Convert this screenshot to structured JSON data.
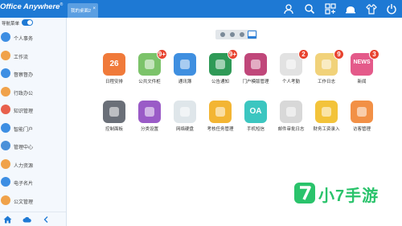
{
  "header": {
    "brand": "Office Anywhere",
    "brand_mark": "®",
    "tab_label": "我的桌面2",
    "tab_close": "×",
    "icons": [
      "user-icon",
      "search-icon",
      "apps-icon",
      "chat-icon",
      "theme-icon",
      "power-icon"
    ]
  },
  "sidebar": {
    "toggle_label": "导航菜单",
    "toggle_on": true,
    "items": [
      {
        "label": "个人事务",
        "icon": "person-icon",
        "color": "#3d8ee3"
      },
      {
        "label": "工作流",
        "icon": "workflow-icon",
        "color": "#f0a24a"
      },
      {
        "label": "督察督办",
        "icon": "supervise-icon",
        "color": "#3d8ee3"
      },
      {
        "label": "行政办公",
        "icon": "admin-icon",
        "color": "#f0a24a"
      },
      {
        "label": "知识管理",
        "icon": "knowledge-icon",
        "color": "#e8604c"
      },
      {
        "label": "智能门户",
        "icon": "portal-icon",
        "color": "#3d8ee3"
      },
      {
        "label": "管理中心",
        "icon": "management-icon",
        "color": "#4a90d9"
      },
      {
        "label": "人力资源",
        "icon": "hr-icon",
        "color": "#f0a24a"
      },
      {
        "label": "电子名片",
        "icon": "card-icon",
        "color": "#3d8ee3"
      },
      {
        "label": "公文管理",
        "icon": "document-icon",
        "color": "#f0a24a"
      }
    ],
    "footer_icons": [
      "home-icon",
      "cloud-icon",
      "collapse-icon"
    ]
  },
  "pager": {
    "pages": 3,
    "icon": "grid-icon"
  },
  "apps": [
    {
      "label": "日程安排",
      "icon": "calendar-icon",
      "color": "#f07a3a",
      "badge": "",
      "glyph": "26"
    },
    {
      "label": "公共文件柜",
      "icon": "file-cabinet-icon",
      "color": "#7cc36a",
      "badge": "9+",
      "glyph": ""
    },
    {
      "label": "通讯簿",
      "icon": "address-book-icon",
      "color": "#3f8fe0",
      "badge": "",
      "glyph": ""
    },
    {
      "label": "公告通知",
      "icon": "announcement-icon",
      "color": "#2f9a57",
      "badge": "9+",
      "glyph": ""
    },
    {
      "label": "门户模版管理",
      "icon": "portal-template-icon",
      "color": "#c0477a",
      "badge": "",
      "glyph": ""
    },
    {
      "label": "个人考勤",
      "icon": "attendance-icon",
      "color": "#e2e2e2",
      "badge": "2",
      "glyph": ""
    },
    {
      "label": "工作日志",
      "icon": "work-log-icon",
      "color": "#f1d27a",
      "badge": "9",
      "glyph": ""
    },
    {
      "label": "新闻",
      "icon": "news-icon",
      "color": "#e45a8a",
      "badge": "3",
      "glyph": "NEWS"
    },
    {
      "label": "控制面板",
      "icon": "control-panel-icon",
      "color": "#6a6f78",
      "badge": "",
      "glyph": ""
    },
    {
      "label": "分类设置",
      "icon": "category-icon",
      "color": "#9a5bc7",
      "badge": "",
      "glyph": ""
    },
    {
      "label": "网络硬盘",
      "icon": "network-disk-icon",
      "color": "#dfe6ea",
      "badge": "",
      "glyph": ""
    },
    {
      "label": "考核任务管理",
      "icon": "assessment-icon",
      "color": "#f3b533",
      "badge": "",
      "glyph": ""
    },
    {
      "label": "手机短信",
      "icon": "sms-icon",
      "color": "#3cc6c0",
      "badge": "",
      "glyph": "OA"
    },
    {
      "label": "邮件审批日志",
      "icon": "mail-log-icon",
      "color": "#d8d8d8",
      "badge": "",
      "glyph": ""
    },
    {
      "label": "财务工资录入",
      "icon": "salary-icon",
      "color": "#f3c33a",
      "badge": "",
      "glyph": ""
    },
    {
      "label": "访客管理",
      "icon": "visitor-icon",
      "color": "#f29046",
      "badge": "",
      "glyph": ""
    }
  ],
  "watermark": {
    "text": "小7手游",
    "logo_glyph": "7"
  }
}
